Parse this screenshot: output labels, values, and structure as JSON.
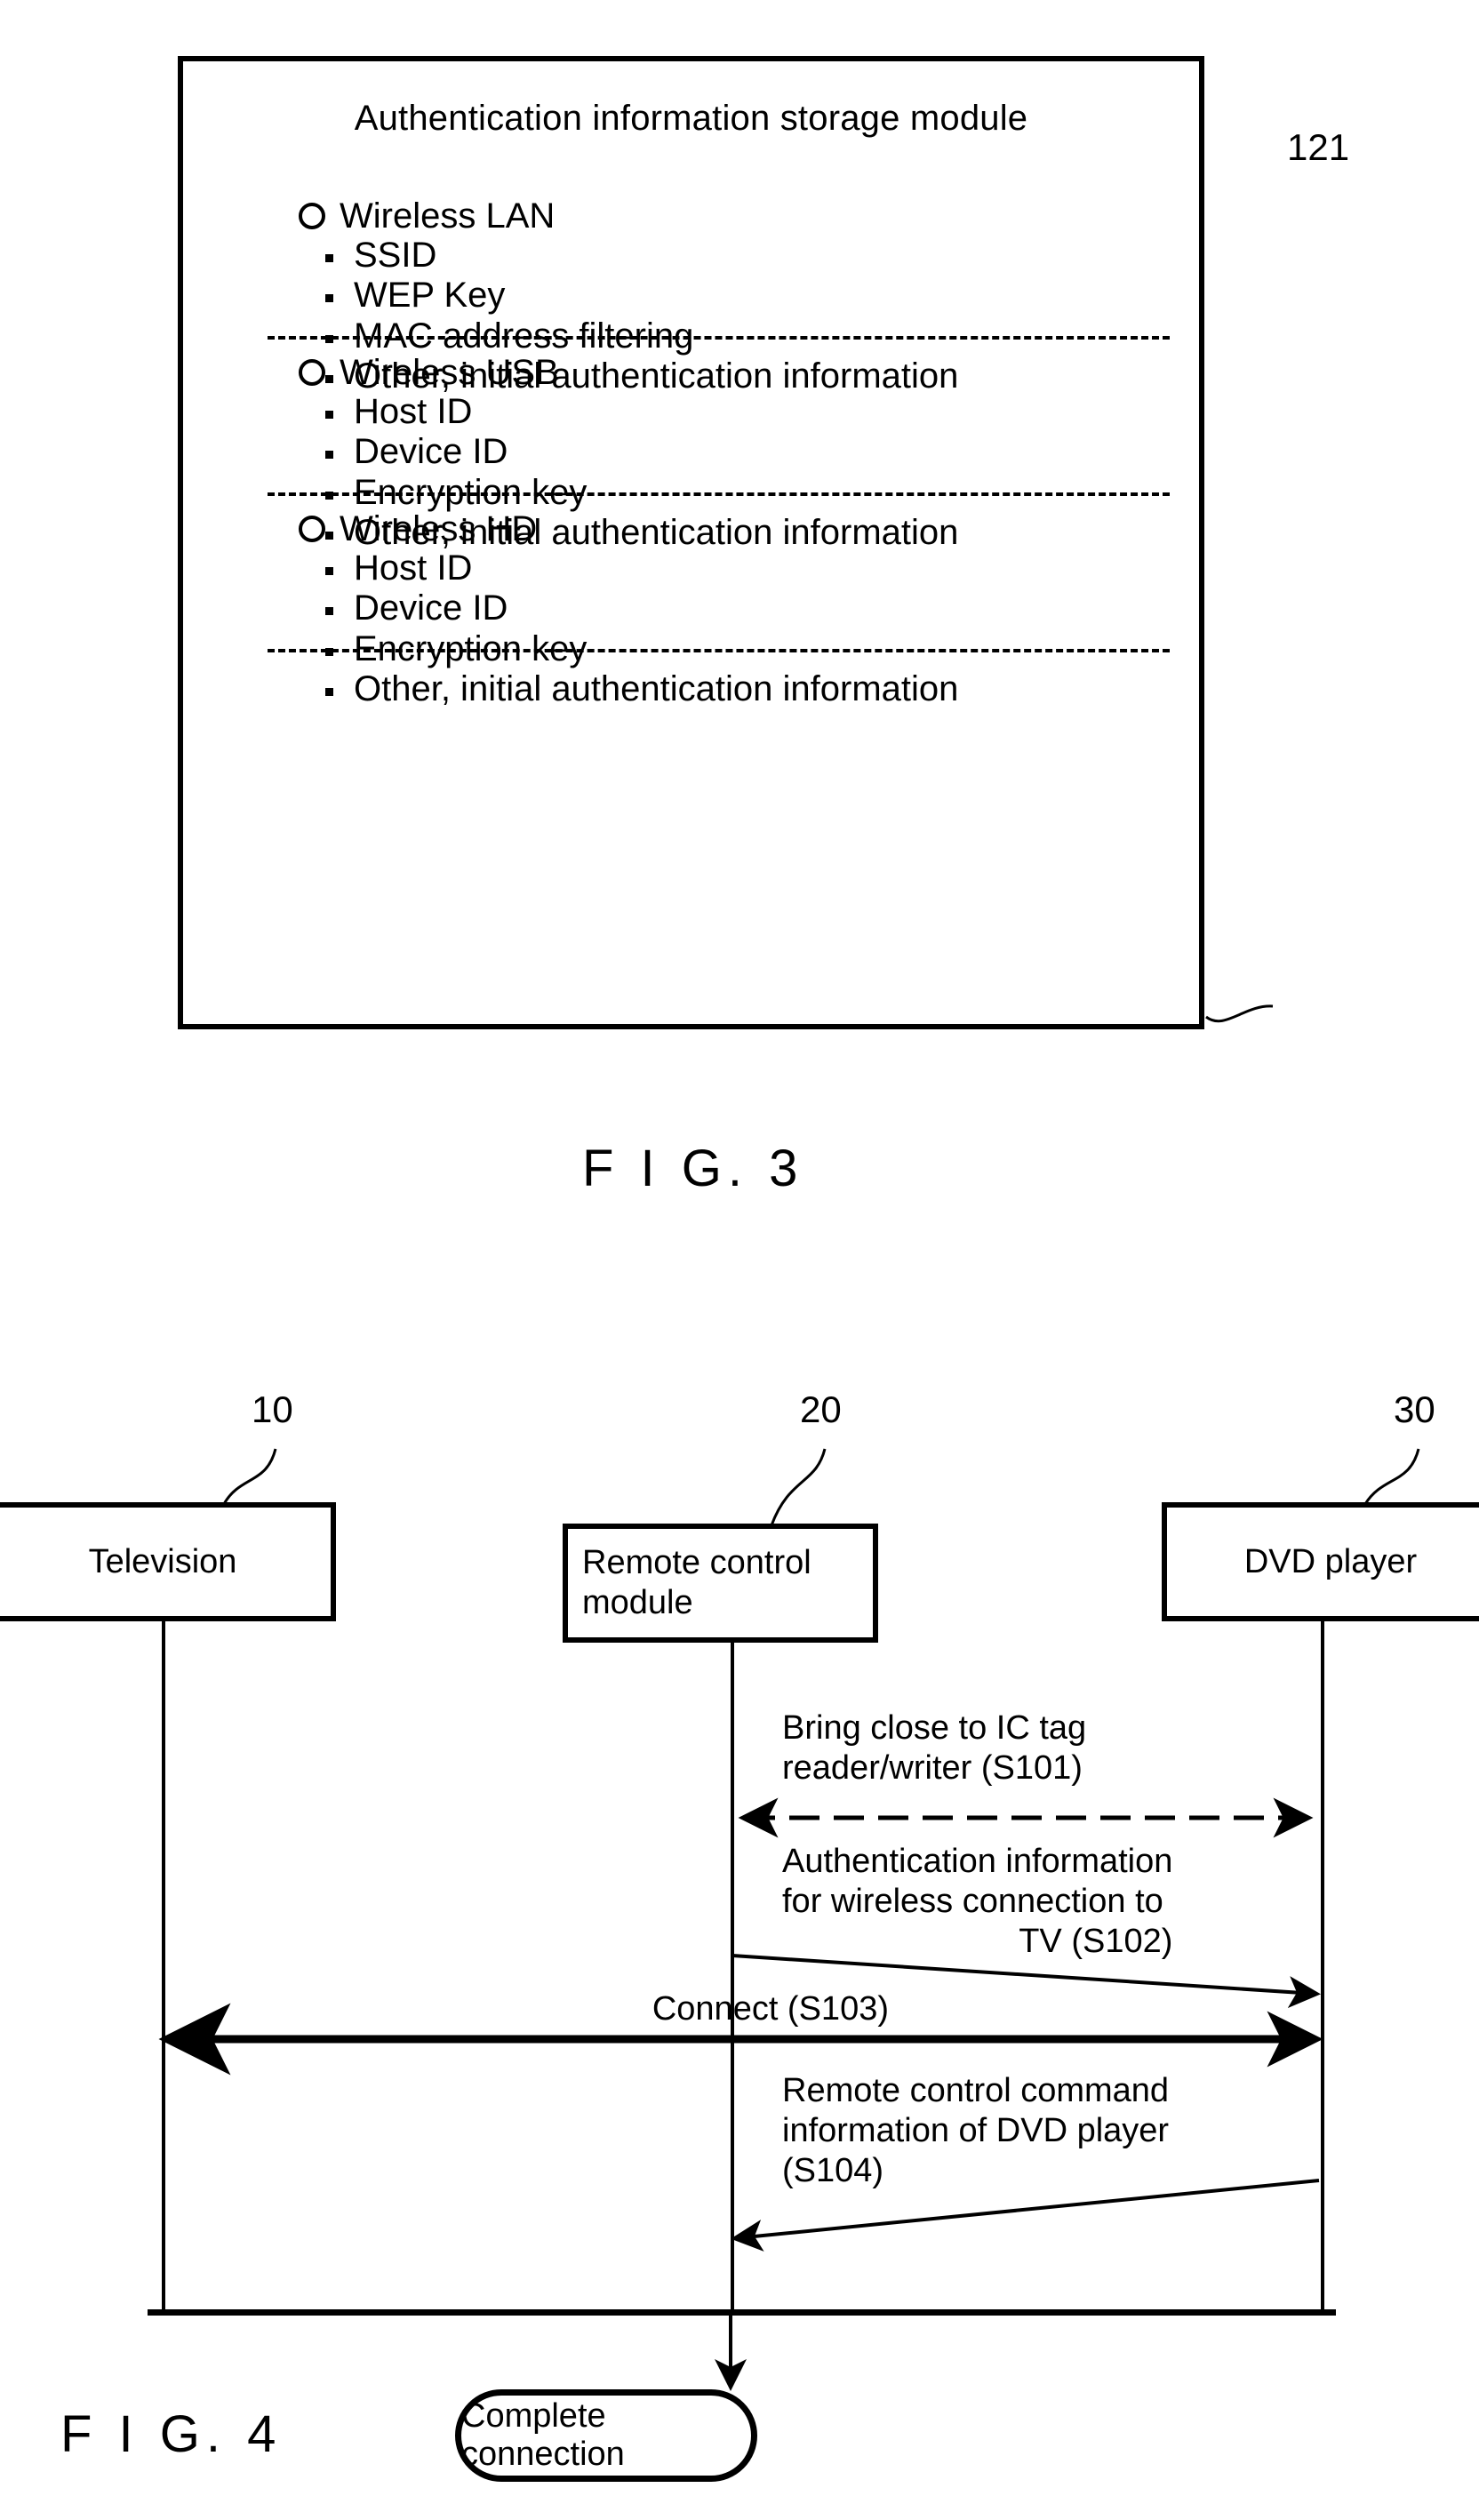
{
  "figure3": {
    "caption": "F I G. 3",
    "reference_number": "121",
    "box_title": "Authentication information storage module",
    "groups": [
      {
        "name": "Wireless LAN",
        "items": [
          "SSID",
          "WEP Key",
          "MAC address filtering",
          "Other, initial authentication information"
        ]
      },
      {
        "name": "Wireless USB",
        "items": [
          "Host ID",
          "Device ID",
          "Encryption key",
          "Other, initial authentication information"
        ]
      },
      {
        "name": "Wireless HD",
        "items": [
          "Host ID",
          "Device ID",
          "Encryption key",
          "Other, initial authentication information"
        ]
      }
    ]
  },
  "figure4": {
    "caption": "F I G. 4",
    "actors": [
      {
        "label": "Television",
        "reference_number": "10"
      },
      {
        "label": "Remote control module",
        "reference_number": "20"
      },
      {
        "label": "DVD player",
        "reference_number": "30"
      }
    ],
    "messages": [
      {
        "step": "S101",
        "text_lines": [
          "Bring close to IC tag",
          "reader/writer (S101)"
        ],
        "from": "Remote control module",
        "to": "DVD player",
        "style": "dashed double-arrow"
      },
      {
        "step": "S102",
        "text_lines": [
          "Authentication information",
          "for wireless connection to",
          "TV (S102)"
        ],
        "from": "Remote control module",
        "to": "DVD player",
        "style": "solid slanted arrow"
      },
      {
        "step": "S103",
        "text_lines": [
          "Connect (S103)"
        ],
        "from": "Television",
        "to": "DVD player",
        "style": "thick double-arrow"
      },
      {
        "step": "S104",
        "text_lines": [
          "Remote control command",
          "information of DVD player",
          "(S104)"
        ],
        "from": "DVD player",
        "to": "Remote control module",
        "style": "solid slanted arrow"
      }
    ],
    "terminator": "Complete connection"
  },
  "colors": {
    "ink": "#000000",
    "paper": "#ffffff"
  }
}
